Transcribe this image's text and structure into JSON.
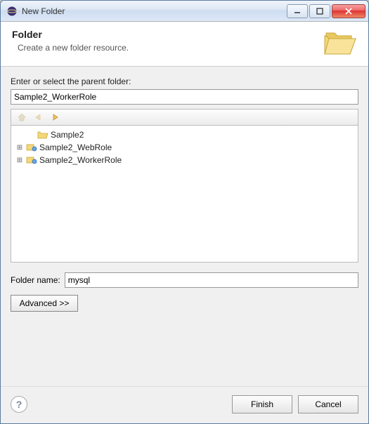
{
  "window": {
    "title": "New Folder"
  },
  "header": {
    "title": "Folder",
    "subtitle": "Create a new folder resource."
  },
  "form": {
    "parent_label": "Enter or select the parent folder:",
    "parent_value": "Sample2_WorkerRole",
    "name_label": "Folder name:",
    "name_value": "mysql",
    "advanced_label": "Advanced >>"
  },
  "tree": {
    "items": [
      {
        "label": "Sample2",
        "expandable": false,
        "icon": "folder-open"
      },
      {
        "label": "Sample2_WebRole",
        "expandable": true,
        "icon": "role"
      },
      {
        "label": "Sample2_WorkerRole",
        "expandable": true,
        "icon": "role"
      }
    ]
  },
  "footer": {
    "finish_label": "Finish",
    "cancel_label": "Cancel"
  }
}
